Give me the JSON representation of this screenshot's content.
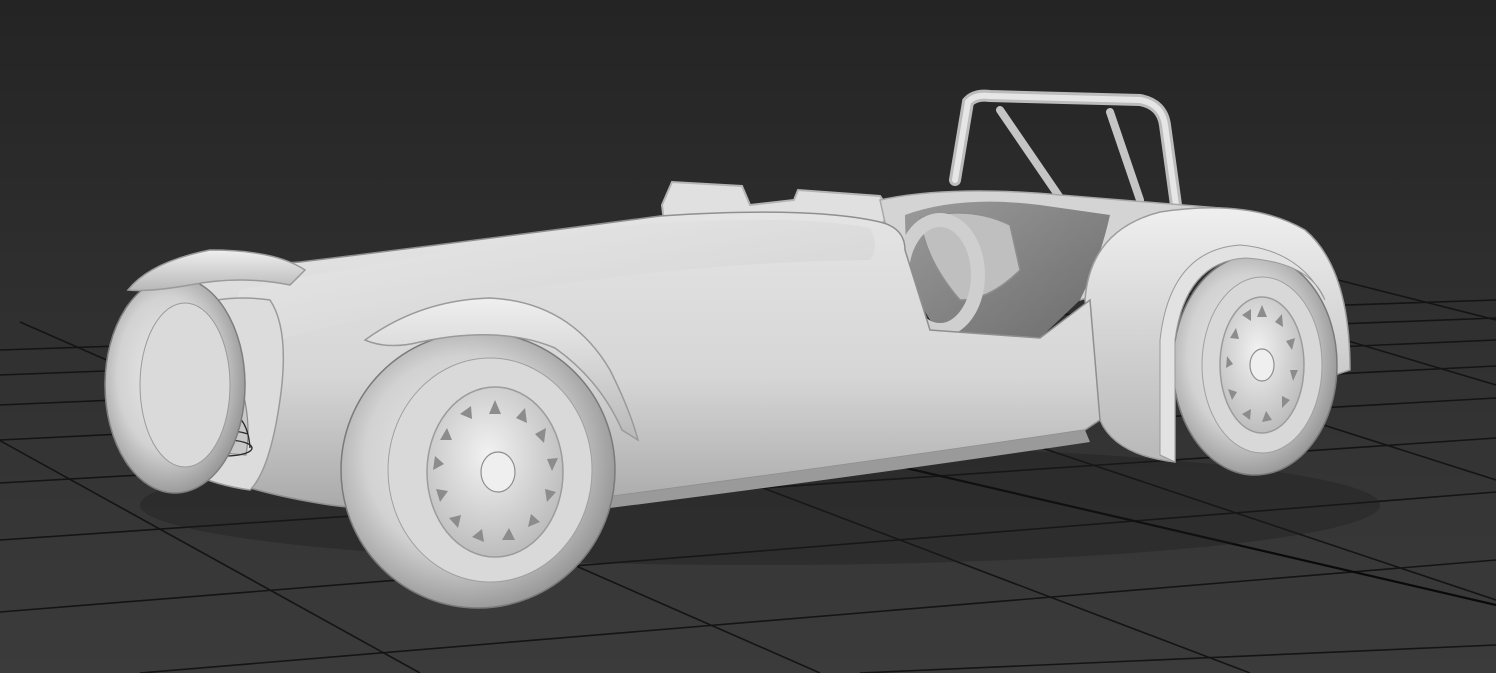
{
  "viewport": {
    "view": "perspective",
    "shading": "default-shading",
    "background_color": "#2b2b2b",
    "grid_color": "#141414",
    "model_color": "#d6d6d6",
    "model": {
      "name": "roadster-model",
      "parts": [
        "body",
        "roll-bar",
        "windscreen",
        "cockpit",
        "front-fender-left",
        "front-fender-right",
        "rear-fender",
        "front-wheel",
        "rear-wheel",
        "left-front-wheel",
        "headlight"
      ]
    }
  }
}
